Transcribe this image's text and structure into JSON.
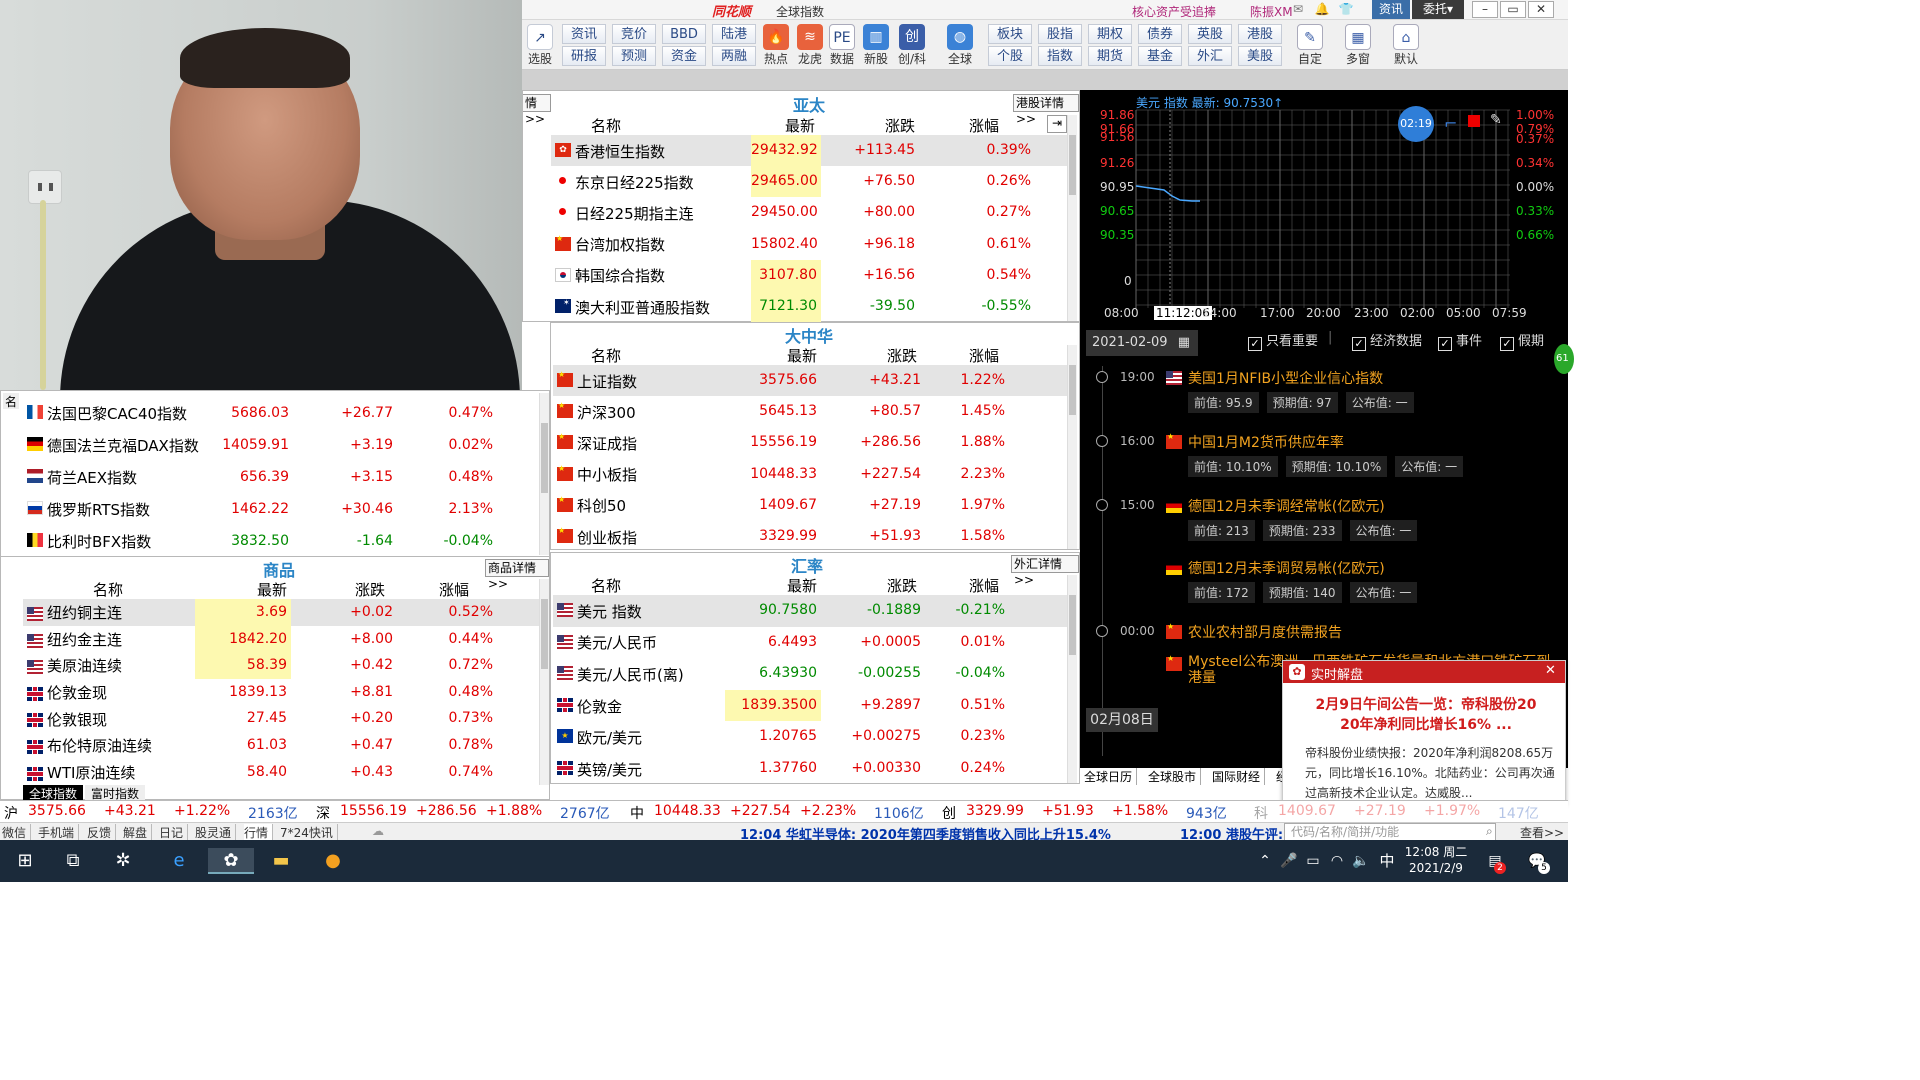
{
  "app": {
    "logo": "同花顺",
    "window_title": "全球指数",
    "ad_text": "核心资产受追捧",
    "user": "陈振XM",
    "news_btn": "资讯",
    "trade_btn": "委托",
    "trade_arrow": "▾",
    "win_min": "–",
    "win_max": "▭",
    "win_close": "✕"
  },
  "toolbar": {
    "select": "选股",
    "groups": [
      {
        "top": "资讯",
        "bot": "研报"
      },
      {
        "top": "竞价",
        "bot": "预测"
      },
      {
        "top": "BBD",
        "bot": "资金"
      },
      {
        "top": "陆港",
        "bot": "两融"
      }
    ],
    "icons": [
      "热点",
      "龙虎",
      "数据",
      "新股",
      "创/科",
      "全球"
    ],
    "groups2": [
      {
        "top": "板块",
        "bot": "个股"
      },
      {
        "top": "股指",
        "bot": "指数"
      },
      {
        "top": "期权",
        "bot": "期货"
      },
      {
        "top": "债券",
        "bot": "基金"
      },
      {
        "top": "英股",
        "bot": "外汇"
      },
      {
        "top": "港股",
        "bot": "美股"
      }
    ],
    "right": [
      "自定",
      "多窗",
      "默认"
    ]
  },
  "cols": {
    "name": "名称",
    "latest": "最新",
    "change": "涨跌",
    "pct": "涨幅"
  },
  "asia": {
    "title": "亚太",
    "more": "港股详情>>",
    "left_more": "情>>",
    "rows": [
      {
        "flag": "hk",
        "name": "香港恒生指数",
        "latest": "29432.92",
        "change": "+113.45",
        "pct": "0.39%"
      },
      {
        "flag": "jp",
        "name": "东京日经225指数",
        "latest": "29465.00",
        "change": "+76.50",
        "pct": "0.26%"
      },
      {
        "flag": "jp",
        "name": "日经225期指主连",
        "latest": "29450.00",
        "change": "+80.00",
        "pct": "0.27%"
      },
      {
        "flag": "cn",
        "name": "台湾加权指数",
        "latest": "15802.40",
        "change": "+96.18",
        "pct": "0.61%"
      },
      {
        "flag": "kr",
        "name": "韩国综合指数",
        "latest": "3107.80",
        "change": "+16.56",
        "pct": "0.54%"
      },
      {
        "flag": "au",
        "name": "澳大利亚普通股指数",
        "latest": "7121.30",
        "change": "-39.50",
        "pct": "-0.55%"
      }
    ]
  },
  "greater_china": {
    "title": "大中华",
    "rows": [
      {
        "flag": "cn",
        "name": "上证指数",
        "latest": "3575.66",
        "change": "+43.21",
        "pct": "1.22%"
      },
      {
        "flag": "cn",
        "name": "沪深300",
        "latest": "5645.13",
        "change": "+80.57",
        "pct": "1.45%"
      },
      {
        "flag": "cn",
        "name": "深证成指",
        "latest": "15556.19",
        "change": "+286.56",
        "pct": "1.88%"
      },
      {
        "flag": "cn",
        "name": "中小板指",
        "latest": "10448.33",
        "change": "+227.54",
        "pct": "2.23%"
      },
      {
        "flag": "cn",
        "name": "科创50",
        "latest": "1409.67",
        "change": "+27.19",
        "pct": "1.97%"
      },
      {
        "flag": "cn",
        "name": "创业板指",
        "latest": "3329.99",
        "change": "+51.93",
        "pct": "1.58%"
      }
    ]
  },
  "forex": {
    "title": "汇率",
    "more": "外汇详情>>",
    "rows": [
      {
        "flag": "us",
        "name": "美元 指数",
        "latest": "90.7580",
        "change": "-0.1889",
        "pct": "-0.21%"
      },
      {
        "flag": "us",
        "name": "美元/人民币",
        "latest": "6.4493",
        "change": "+0.0005",
        "pct": "0.01%"
      },
      {
        "flag": "us",
        "name": "美元/人民币(离)",
        "latest": "6.43930",
        "change": "-0.00255",
        "pct": "-0.04%"
      },
      {
        "flag": "uk",
        "name": "伦敦金",
        "latest": "1839.3500",
        "change": "+9.2897",
        "pct": "0.51%"
      },
      {
        "flag": "eu",
        "name": "欧元/美元",
        "latest": "1.20765",
        "change": "+0.00275",
        "pct": "0.23%"
      },
      {
        "flag": "uk",
        "name": "英镑/美元",
        "latest": "1.37760",
        "change": "+0.00330",
        "pct": "0.24%"
      }
    ]
  },
  "europe": {
    "side_label": "名",
    "rows": [
      {
        "flag": "fr",
        "name": "法国巴黎CAC40指数",
        "latest": "5686.03",
        "change": "+26.77",
        "pct": "0.47%"
      },
      {
        "flag": "de",
        "name": "德国法兰克福DAX指数",
        "latest": "14059.91",
        "change": "+3.19",
        "pct": "0.02%"
      },
      {
        "flag": "nl",
        "name": "荷兰AEX指数",
        "latest": "656.39",
        "change": "+3.15",
        "pct": "0.48%"
      },
      {
        "flag": "ru",
        "name": "俄罗斯RTS指数",
        "latest": "1462.22",
        "change": "+30.46",
        "pct": "2.13%"
      },
      {
        "flag": "be",
        "name": "比利时BFX指数",
        "latest": "3832.50",
        "change": "-1.64",
        "pct": "-0.04%"
      }
    ]
  },
  "commodities": {
    "title": "商品",
    "more": "商品详情>>",
    "rows": [
      {
        "flag": "us",
        "name": "纽约铜主连",
        "latest": "3.69",
        "change": "+0.02",
        "pct": "0.52%"
      },
      {
        "flag": "us",
        "name": "纽约金主连",
        "latest": "1842.20",
        "change": "+8.00",
        "pct": "0.44%"
      },
      {
        "flag": "us",
        "name": "美原油连续",
        "latest": "58.39",
        "change": "+0.42",
        "pct": "0.72%"
      },
      {
        "flag": "uk",
        "name": "伦敦金现",
        "latest": "1839.13",
        "change": "+8.81",
        "pct": "0.48%"
      },
      {
        "flag": "uk",
        "name": "伦敦银现",
        "latest": "27.45",
        "change": "+0.20",
        "pct": "0.73%"
      },
      {
        "flag": "uk",
        "name": "布伦特原油连续",
        "latest": "61.03",
        "change": "+0.47",
        "pct": "0.78%"
      },
      {
        "flag": "uk",
        "name": "WTI原油连续",
        "latest": "58.40",
        "change": "+0.43",
        "pct": "0.74%"
      }
    ],
    "tabs": [
      "全球指数",
      "富时指数"
    ]
  },
  "mini_chart": {
    "header": "美元 指数 最新: 90.7530↑",
    "timer": "02:19",
    "y_left": [
      "91.86",
      "91.66",
      "91.56",
      "91.26",
      "90.95",
      "90.65",
      "90.35",
      "0"
    ],
    "y_right": [
      "1.00%",
      "0.79%",
      "0.37%",
      "0.34%",
      "0.00%",
      "0.33%",
      "0.66%"
    ],
    "x_labels": [
      "08:00",
      "11:12:06",
      "14:00",
      "17:00",
      "20:00",
      "23:00",
      "02:00",
      "05:00",
      "07:59"
    ]
  },
  "calendar": {
    "date": "2021-02-09",
    "filters": [
      "只看重要",
      "经济数据",
      "事件",
      "假期"
    ],
    "badge": "61",
    "events": [
      {
        "time": "19:00",
        "flag": "us",
        "title": "美国1月NFIB小型企业信心指数",
        "prev": "前值: 95.9",
        "exp": "预期值: 97",
        "pub": "公布值: 一"
      },
      {
        "time": "16:00",
        "flag": "cn",
        "title": "中国1月M2货币供应年率",
        "prev": "前值: 10.10%",
        "exp": "预期值: 10.10%",
        "pub": "公布值: 一"
      },
      {
        "time": "15:00",
        "flag": "de",
        "title": "德国12月未季调经常帐(亿欧元)",
        "prev": "前值: 213",
        "exp": "预期值: 233",
        "pub": "公布值: 一"
      },
      {
        "time": "",
        "flag": "de",
        "title": "德国12月未季调贸易帐(亿欧元)",
        "prev": "前值: 172",
        "exp": "预期值: 140",
        "pub": "公布值: 一"
      },
      {
        "time": "00:00",
        "flag": "cn",
        "title": "农业农村部月度供需报告",
        "prev": "",
        "exp": "",
        "pub": ""
      },
      {
        "time": "",
        "flag": "cn",
        "title": "Mysteel公布澳洲、巴西铁矿石发货量和北方港口铁矿石到港量",
        "prev": "",
        "exp": "",
        "pub": ""
      }
    ],
    "prev_date": "02月08日",
    "bottom_tabs": [
      "全球日历",
      "全球股市",
      "国际财经",
      "经"
    ]
  },
  "popup": {
    "title": "实时解盘",
    "headline": "2月9日午间公告一览：帝科股份20 20年净利同比增长16% ...",
    "body": "帝科股份业绩快报：2020年净利润8208.65万元，同比增长16.10%。北陆药业：公司再次通过高新技术企业认定。达威股...",
    "search_placeholder": "代码/名称/简拼/功能",
    "view": "查看>>"
  },
  "ticker": [
    {
      "label": "沪",
      "v1": "3575.66",
      "v2": "+43.21",
      "v3": "+1.22%",
      "v4": "2163亿"
    },
    {
      "label": "深",
      "v1": "15556.19",
      "v2": "+286.56",
      "v3": "+1.88%",
      "v4": "2767亿"
    },
    {
      "label": "中",
      "v1": "10448.33",
      "v2": "+227.54",
      "v3": "+2.23%",
      "v4": "1106亿"
    },
    {
      "label": "创",
      "v1": "3329.99",
      "v2": "+51.93",
      "v3": "+1.58%",
      "v4": "943亿"
    },
    {
      "label": "科",
      "v1": "1409.67",
      "v2": "+27.19",
      "v3": "+1.97%",
      "v4": "147亿"
    }
  ],
  "status": {
    "items": [
      "微信",
      "手机端",
      "反馈",
      "解盘",
      "日记",
      "股灵通",
      "行情",
      "7*24快讯"
    ],
    "news1": "12:04 华虹半导体: 2020年第四季度销售收入同比上升15.4%",
    "news2": "12:00 港股午评:"
  },
  "taskbar": {
    "time": "12:08 周二",
    "date": "2021/2/9",
    "ime": "中",
    "notif": "2",
    "chat": "5"
  }
}
